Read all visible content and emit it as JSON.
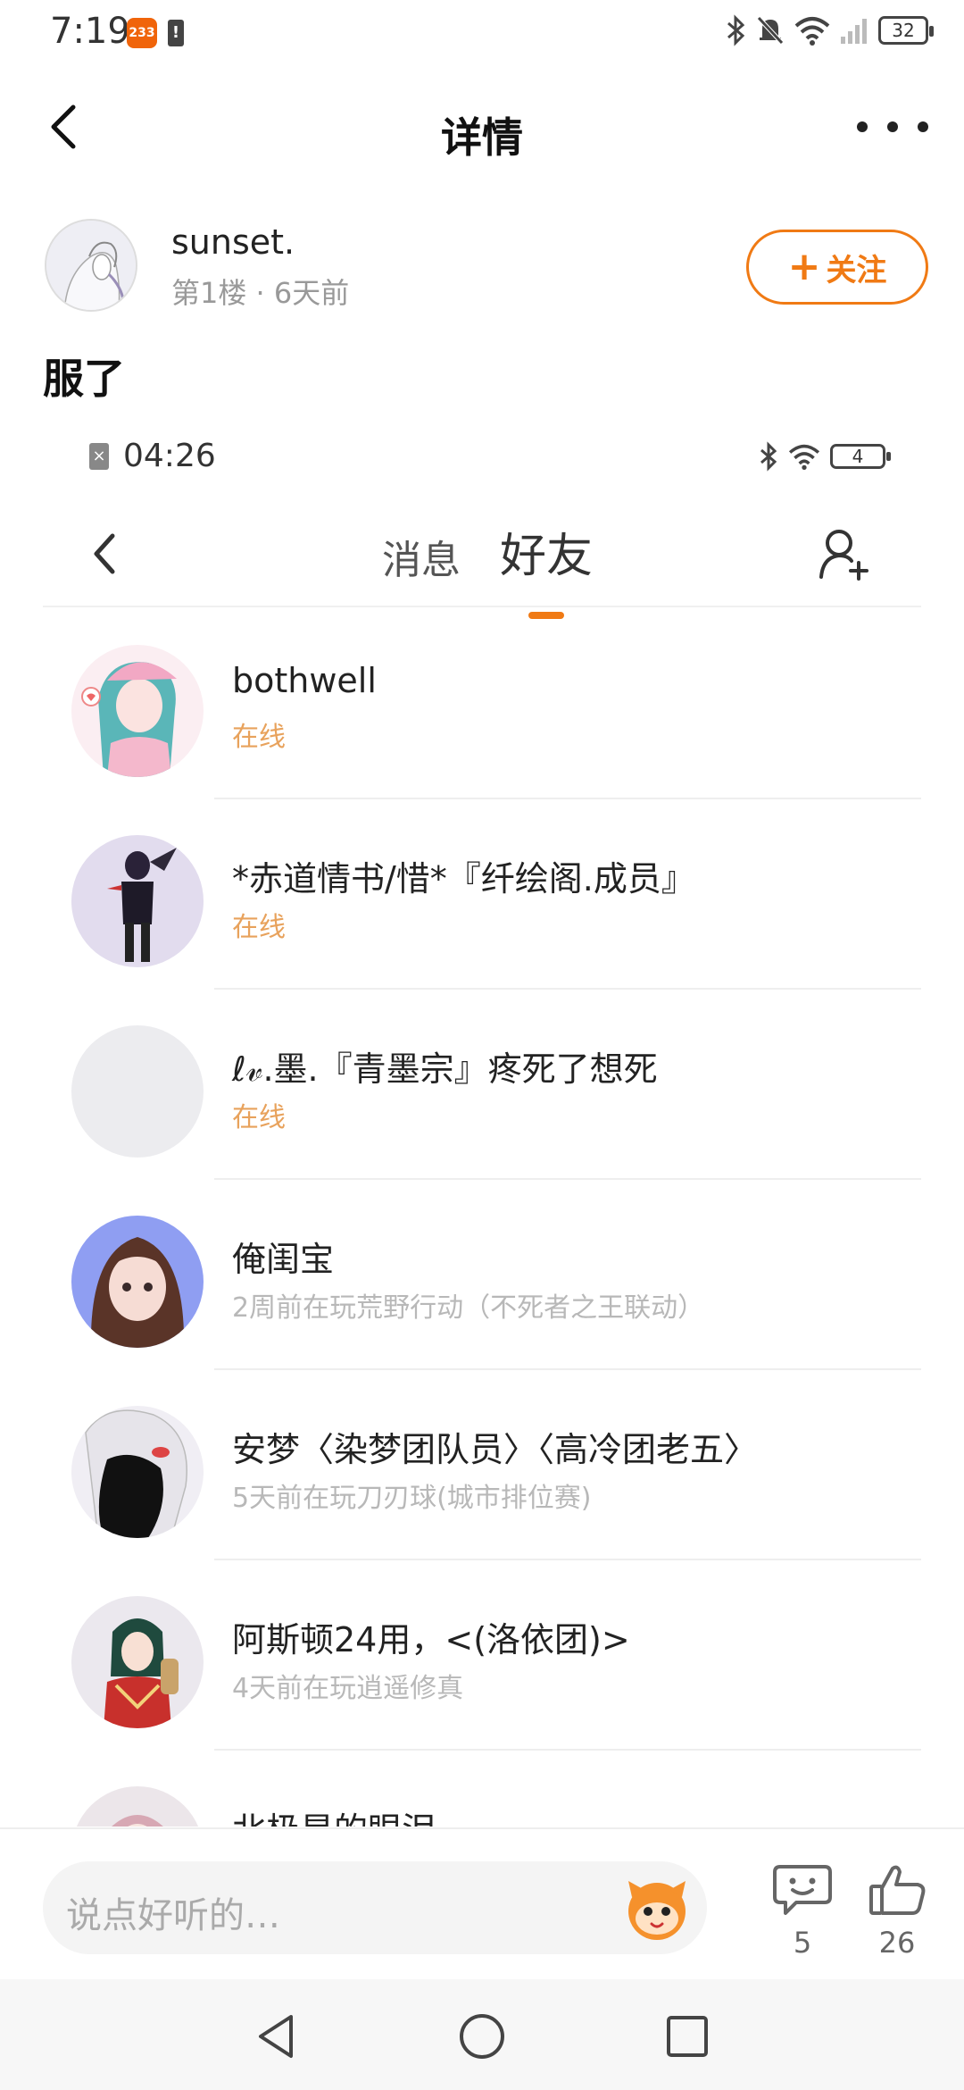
{
  "status_bar": {
    "time": "7:19",
    "app_badge": "233",
    "battery": "32",
    "icons": [
      "bluetooth-icon",
      "mute-bell-icon",
      "wifi-icon",
      "signal-icon",
      "battery-icon"
    ]
  },
  "nav": {
    "title": "详情",
    "back_icon": "chevron-left-icon",
    "more_icon": "more-dots-icon"
  },
  "post": {
    "author": "sunset.",
    "meta": "第1楼 · 6天前",
    "follow_label": "关注",
    "follow_plus": "+",
    "text": "服了"
  },
  "screenshot": {
    "status_time": "04:26",
    "battery": "4",
    "tabs": [
      {
        "label": "消息",
        "active": false
      },
      {
        "label": "好友",
        "active": true
      }
    ],
    "friends": [
      {
        "name": "bothwell",
        "status": "在线",
        "online": true
      },
      {
        "name": "*赤道情书/惜*『纤绘阁.成员』",
        "status": "在线",
        "online": true
      },
      {
        "name": "ℓ𝓋.墨.『青墨宗』疼死了想死",
        "status": "在线",
        "online": true
      },
      {
        "name": "俺闺宝",
        "status": "2周前在玩荒野行动（不死者之王联动）",
        "online": false
      },
      {
        "name": "安梦〈染梦团队员〉〈高冷团老五〉",
        "status": "5天前在玩刀刃球(城市排位赛)",
        "online": false
      },
      {
        "name": "阿斯顿24用，<(洛依团)>",
        "status": "4天前在玩逍遥修真",
        "online": false
      },
      {
        "name": "北极星的眼泪",
        "status": "",
        "online": false
      }
    ]
  },
  "bottom_bar": {
    "comment_placeholder": "说点好听的…",
    "comment_count": "5",
    "like_count": "26"
  },
  "colors": {
    "accent": "#f07a14",
    "online": "#e8a25c",
    "offline": "#b8b8b8"
  }
}
